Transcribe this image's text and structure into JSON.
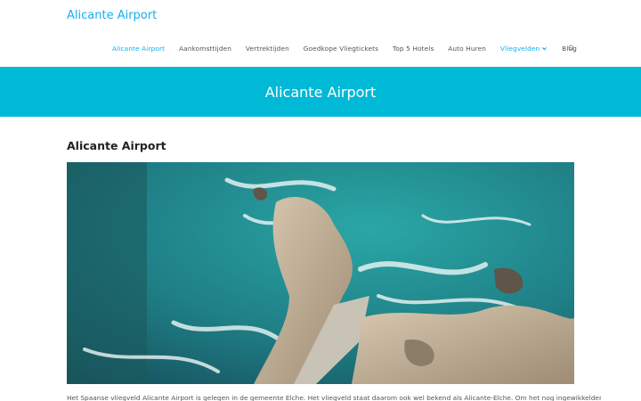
{
  "site": {
    "title": "Alicante Airport"
  },
  "nav": {
    "items": [
      {
        "label": "Alicante Airport",
        "active": true
      },
      {
        "label": "Aankomsttijden",
        "active": false
      },
      {
        "label": "Vertrektijden",
        "active": false
      },
      {
        "label": "Goedkope Vliegtickets",
        "active": false
      },
      {
        "label": "Top 5 Hotels",
        "active": false
      },
      {
        "label": "Auto Huren",
        "active": false
      },
      {
        "label": "Vliegvelden",
        "active": true,
        "dropdown": true
      },
      {
        "label": "Blog",
        "active": false
      }
    ],
    "search_icon": "search-icon"
  },
  "banner": {
    "title": "Alicante Airport"
  },
  "post": {
    "title": "Alicante Airport",
    "intro": "Het Spaanse vliegveld Alicante Airport is gelegen in de gemeente Elche. Het vliegveld staat daarom ook wel bekend als Alicante-Elche. Om het nog ingewikkelder"
  },
  "colors": {
    "accent": "#13aff0",
    "banner": "#00b9d6"
  }
}
